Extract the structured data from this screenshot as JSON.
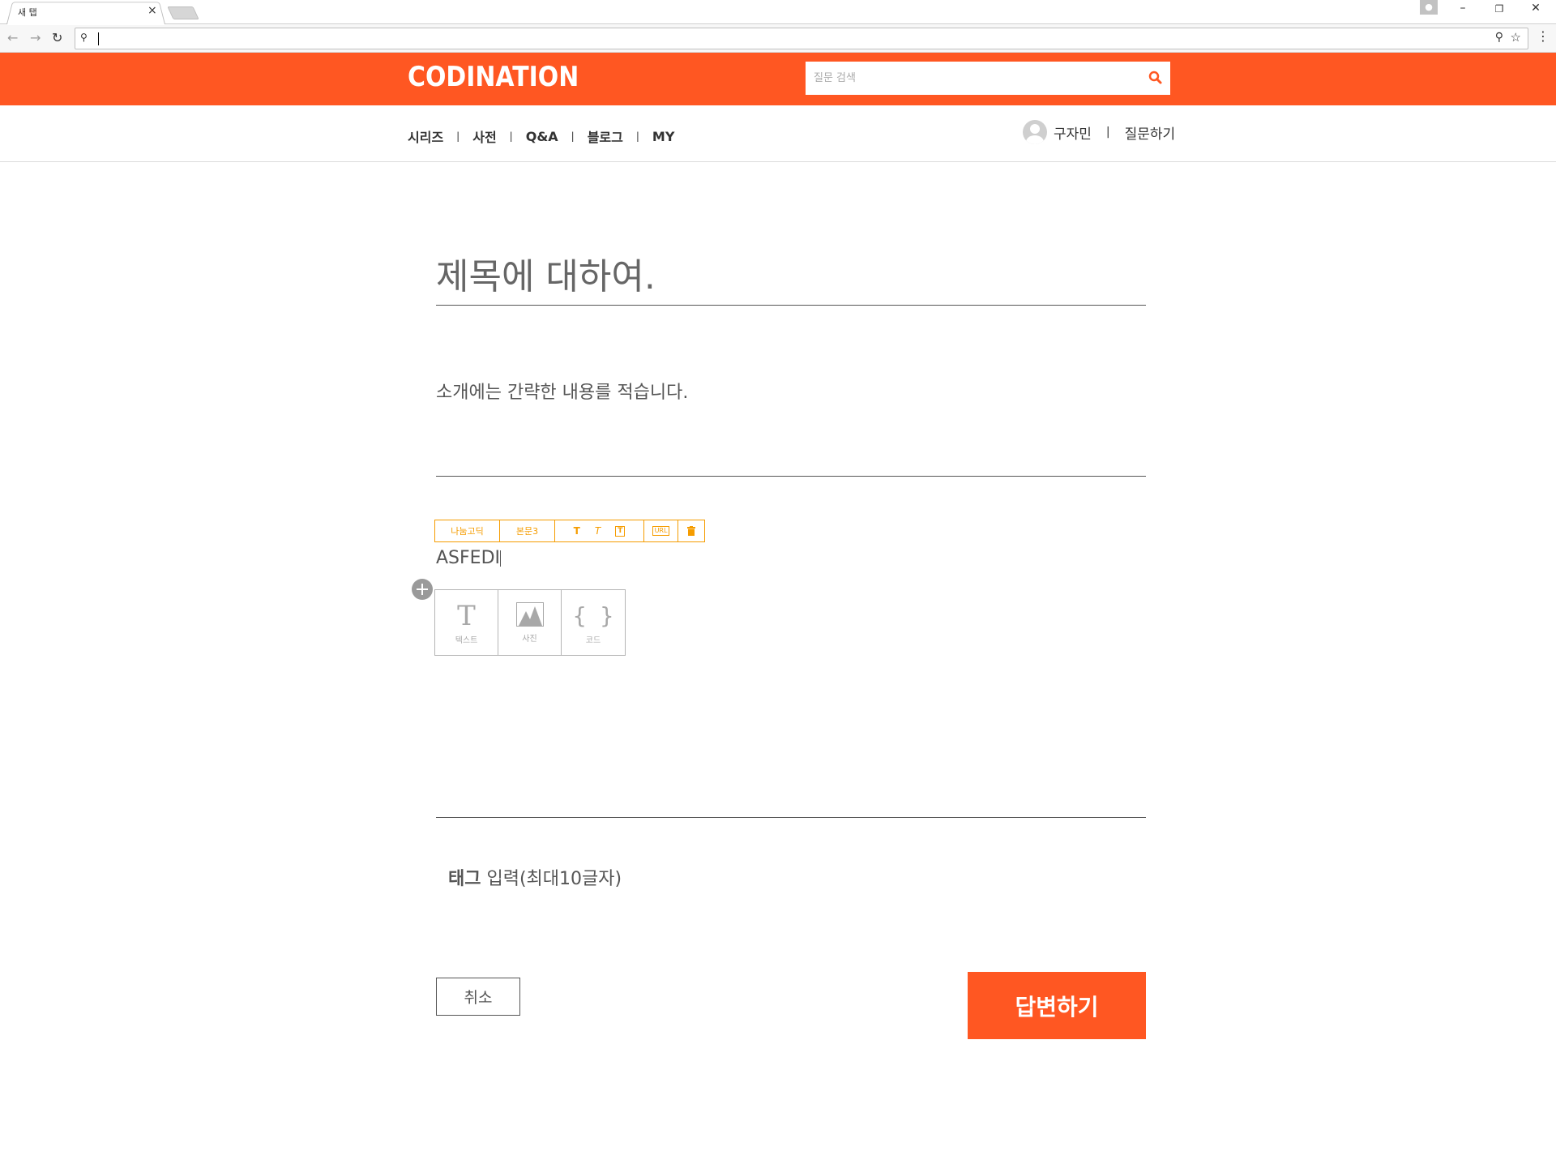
{
  "browser": {
    "tab_title": "새 탭",
    "tab_close": "×",
    "address_value": "",
    "icons": {
      "back": "arrow-left",
      "forward": "arrow-right",
      "reload": "reload",
      "omnibox_search": "magnifier",
      "zoom": "zoom-out",
      "bookmark": "star",
      "menu": "vertical-dots",
      "profile": "person",
      "minimize": "minimize",
      "restore": "restore",
      "close": "close"
    }
  },
  "header": {
    "logo": "CODINATION",
    "search_placeholder": "질문 검색",
    "brand_color": "#ff5722"
  },
  "nav": {
    "items": [
      "시리즈",
      "사전",
      "Q&A",
      "블로그",
      "MY"
    ],
    "user_name": "구자민",
    "ask_label": "질문하기"
  },
  "editor": {
    "title": "제목에 대하여.",
    "intro": "소개에는 간략한 내용를 적습니다.",
    "format_bar": {
      "font": "나눔고딕",
      "style": "본문3",
      "bold": "T",
      "italic": "T",
      "box": "T",
      "url": "URL",
      "accent_color": "#f59c00"
    },
    "body_text": "ASFEDI",
    "insert_options": [
      {
        "label": "텍스트",
        "icon": "text-icon"
      },
      {
        "label": "사진",
        "icon": "image-icon"
      },
      {
        "label": "코드",
        "icon": "code-icon"
      }
    ],
    "text_glyph": "T",
    "code_glyph": "{ }"
  },
  "tags": {
    "label": "태그",
    "hint": "입력(최대10글자)"
  },
  "actions": {
    "cancel": "취소",
    "submit": "답변하기"
  }
}
